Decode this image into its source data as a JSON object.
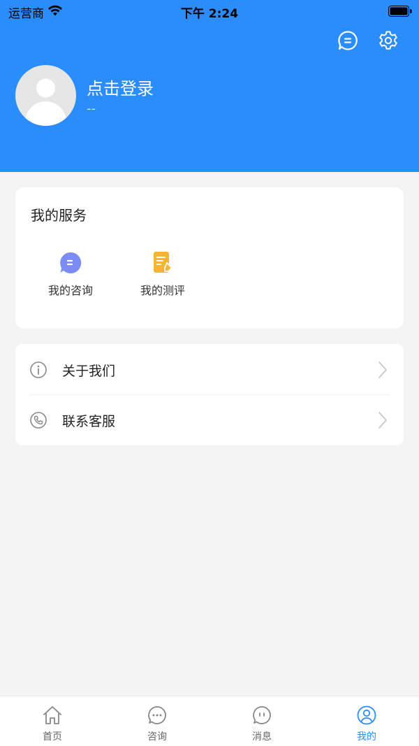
{
  "status_bar": {
    "carrier": "运营商",
    "time": "下午 2:24"
  },
  "profile": {
    "login_label": "点击登录",
    "subtitle": "--"
  },
  "services": {
    "title": "我的服务",
    "items": [
      {
        "label": "我的咨询",
        "icon": "chat-bubble-icon"
      },
      {
        "label": "我的测评",
        "icon": "document-edit-icon"
      }
    ]
  },
  "menu": {
    "items": [
      {
        "label": "关于我们",
        "icon": "info-icon"
      },
      {
        "label": "联系客服",
        "icon": "phone-icon"
      }
    ]
  },
  "tabs": [
    {
      "label": "首页",
      "icon": "home-icon",
      "active": false
    },
    {
      "label": "咨询",
      "icon": "chat-dots-icon",
      "active": false
    },
    {
      "label": "消息",
      "icon": "message-icon",
      "active": false
    },
    {
      "label": "我的",
      "icon": "user-icon",
      "active": true
    }
  ],
  "colors": {
    "primary": "#2b8dfc",
    "background": "#f4f4f4",
    "service_chat": "#7b8cf5",
    "service_doc": "#f5b533"
  }
}
